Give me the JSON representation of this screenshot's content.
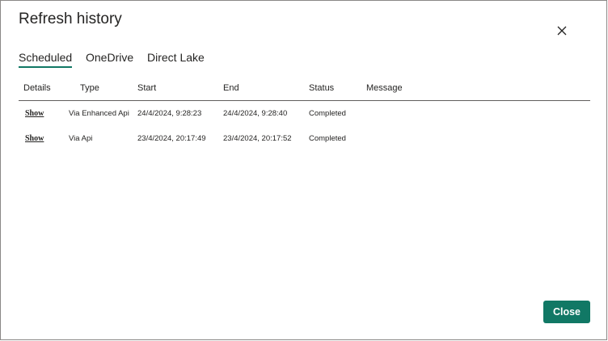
{
  "dialog": {
    "title": "Refresh history",
    "close_button_label": "Close"
  },
  "tabs": [
    {
      "label": "Scheduled",
      "active": true
    },
    {
      "label": "OneDrive",
      "active": false
    },
    {
      "label": "Direct Lake",
      "active": false
    }
  ],
  "table": {
    "columns": [
      "Details",
      "Type",
      "Start",
      "End",
      "Status",
      "Message"
    ],
    "rows": [
      {
        "details": "Show",
        "type": "Via Enhanced Api",
        "start": "24/4/2024, 9:28:23",
        "end": "24/4/2024, 9:28:40",
        "status": "Completed",
        "message": ""
      },
      {
        "details": "Show",
        "type": "Via Api",
        "start": "23/4/2024, 20:17:49",
        "end": "23/4/2024, 20:17:52",
        "status": "Completed",
        "message": ""
      }
    ]
  },
  "colors": {
    "accent": "#117865",
    "text": "#252423",
    "border": "#605e5c"
  },
  "icons": {
    "dismiss": "close-icon"
  }
}
